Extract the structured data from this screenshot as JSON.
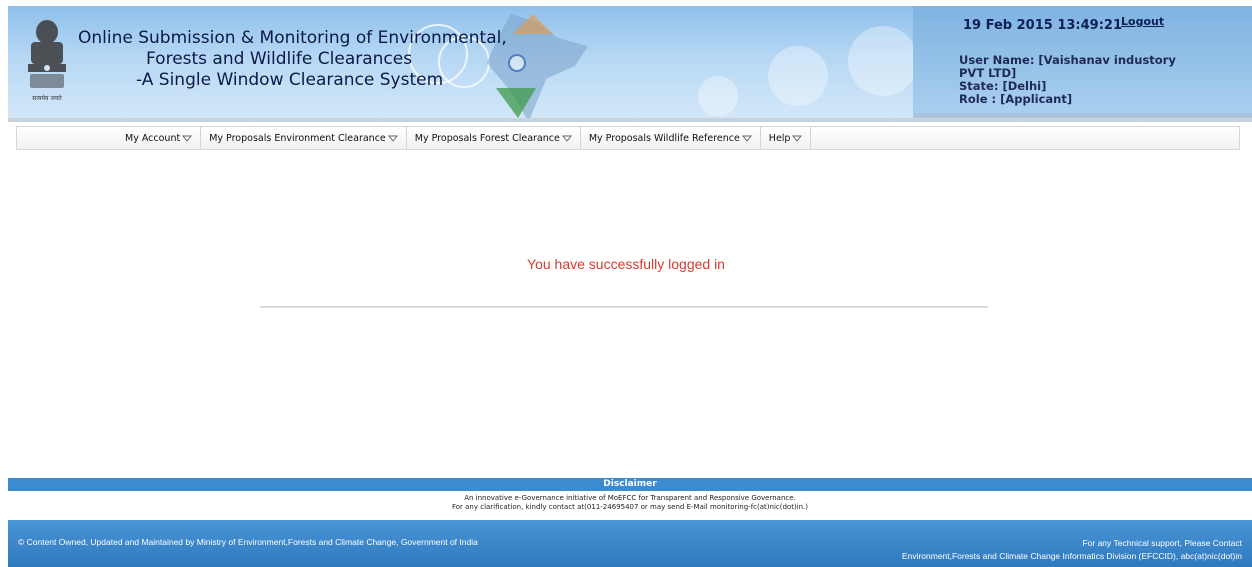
{
  "header": {
    "emblem_caption": "सत्यमेव जयते",
    "title_lines": [
      "Online Submission & Monitoring of Environmental,",
      "Forests and Wildlife Clearances",
      "-A Single Window Clearance System"
    ]
  },
  "user": {
    "datetime": "19 Feb 2015 13:49:21",
    "logout_label": "Logout",
    "name_line1": "User Name: [Vaishanav industory",
    "name_line2": "PVT LTD]",
    "state": "State: [Delhi]",
    "role": "Role : [Applicant]"
  },
  "nav": {
    "items": [
      {
        "label": "My Account"
      },
      {
        "label": "My Proposals Environment Clearance"
      },
      {
        "label": "My Proposals Forest Clearance"
      },
      {
        "label": "My Proposals Wildlife Reference"
      },
      {
        "label": "Help"
      }
    ]
  },
  "main": {
    "message": "You have successfully logged in"
  },
  "footer": {
    "disclaimer_title": "Disclaimer",
    "disclaimer_line1": "An innovative e-Governance initiative of MoEFCC for Transparent and Responsive Governance.",
    "disclaimer_line2": "For any clarification, kindly contact at(011-24695407 or may send E-Mail monitoring-fc(at)nic(dot)in.)",
    "left_text": "© Content Owned, Updated and Maintained by Ministry of Environment,Forests and Climate Change, Government of India",
    "right_line1": "For any Technical support, Please Contact",
    "right_line2": "Environment,Forests and Climate Change Informatics Division (EFCCID), abc(at)nic(dot)in"
  },
  "colors": {
    "header_blue": "#8fc0ea",
    "success_red": "#d93a2e",
    "footer_blue": "#3b8bd0"
  }
}
